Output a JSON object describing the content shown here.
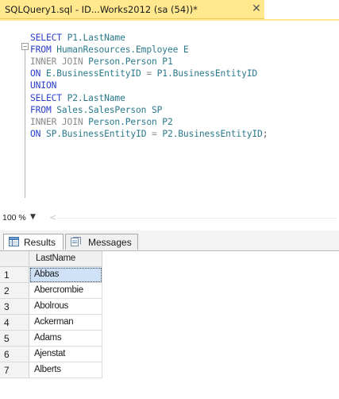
{
  "tab": {
    "title": "SQLQuery1.sql - ID...Works2012 (sa (54))*",
    "close_glyph": "✕"
  },
  "editor": {
    "collapse_glyph": "−",
    "lines": [
      [
        {
          "t": "SELECT ",
          "c": "kw"
        },
        {
          "t": "P1.LastName",
          "c": "id"
        }
      ],
      [
        {
          "t": "FROM ",
          "c": "kw"
        },
        {
          "t": "HumanResources.Employee E",
          "c": "id"
        }
      ],
      [
        {
          "t": "INNER JOIN ",
          "c": "gr"
        },
        {
          "t": "Person.Person P1",
          "c": "id"
        }
      ],
      [
        {
          "t": "ON ",
          "c": "kw"
        },
        {
          "t": "E.BusinessEntityID ",
          "c": "id"
        },
        {
          "t": "= ",
          "c": "gr"
        },
        {
          "t": "P1.BusinessEntityID",
          "c": "id"
        }
      ],
      [
        {
          "t": "UNION",
          "c": "kw"
        }
      ],
      [
        {
          "t": "SELECT ",
          "c": "kw"
        },
        {
          "t": "P2.LastName",
          "c": "id"
        }
      ],
      [
        {
          "t": "FROM ",
          "c": "kw"
        },
        {
          "t": "Sales.SalesPerson SP",
          "c": "id"
        }
      ],
      [
        {
          "t": "INNER JOIN ",
          "c": "gr"
        },
        {
          "t": "Person.Person P2",
          "c": "id"
        }
      ],
      [
        {
          "t": "ON ",
          "c": "kw"
        },
        {
          "t": "SP.BusinessEntityID ",
          "c": "id"
        },
        {
          "t": "= ",
          "c": "gr"
        },
        {
          "t": "P2.BusinessEntityID",
          "c": "id"
        },
        {
          "t": ";",
          "c": "punc"
        }
      ]
    ]
  },
  "zoom": {
    "value": "100 %",
    "dropdown_glyph": "▼",
    "scroll_left_glyph": "<"
  },
  "results_tabs": {
    "results_label": "Results",
    "messages_label": "Messages"
  },
  "grid": {
    "column_header": "LastName",
    "rows": [
      {
        "num": "1",
        "last_name": "Abbas"
      },
      {
        "num": "2",
        "last_name": "Abercrombie"
      },
      {
        "num": "3",
        "last_name": "Abolrous"
      },
      {
        "num": "4",
        "last_name": "Ackerman"
      },
      {
        "num": "5",
        "last_name": "Adams"
      },
      {
        "num": "6",
        "last_name": "Ajenstat"
      },
      {
        "num": "7",
        "last_name": "Alberts"
      }
    ]
  },
  "colors": {
    "tab_active": "#ffe88e",
    "keyword": "#2b3eca",
    "identifier": "#2b7a8c",
    "operator": "#8a8a8a",
    "selected_cell": "#cfe1f7"
  }
}
